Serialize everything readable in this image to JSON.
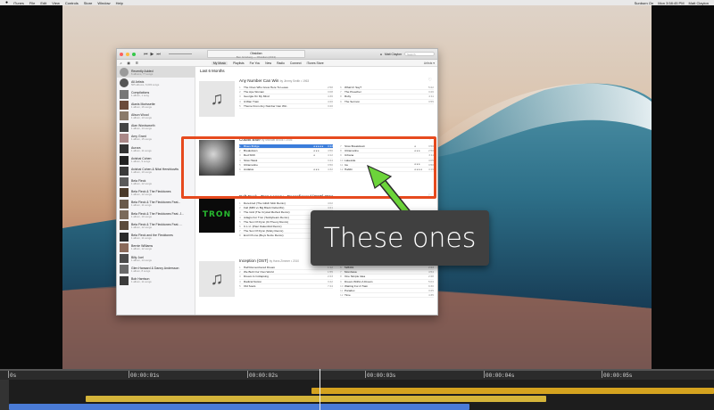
{
  "menubar": {
    "apple": "",
    "items": [
      "iTunes",
      "File",
      "Edit",
      "View",
      "Controls",
      "Store",
      "Window",
      "Help"
    ],
    "right": [
      "Sunburn On",
      "Mon 3:58:45 PM",
      "Matt Clayton"
    ]
  },
  "itunes": {
    "now_playing_title": "Obsidian",
    "now_playing_sub": "Ben Ginsberg — Obsidian (2013)",
    "user": "Matt Clayton",
    "search_placeholder": "Search",
    "nav_tabs": [
      "My Music",
      "Playlists",
      "For You",
      "New",
      "Radio",
      "Connect",
      "iTunes Store"
    ],
    "sort_label": "Artists ▾",
    "section_title": "Last 6 Months",
    "sidebar": [
      {
        "name": "Recently Added",
        "sub": "6 albums, 77 songs"
      },
      {
        "name": "All Artists",
        "sub": "505 albums, 6,003 songs"
      },
      {
        "name": "Compilations",
        "sub": "1 album, 1 song"
      },
      {
        "name": "Alanis Morissette",
        "sub": "1 album, 16 songs"
      },
      {
        "name": "Alison Wood",
        "sub": "1 album, 13 songs"
      },
      {
        "name": "Alan Wordsworth",
        "sub": "1 album, 14 songs"
      },
      {
        "name": "Amy Grant",
        "sub": "1 album, 15 songs"
      },
      {
        "name": "Aurora",
        "sub": "1 album, 11 songs"
      },
      {
        "name": "Avishai Cohen",
        "sub": "1 album, 9 songs"
      },
      {
        "name": "Avishai Cohen & Nitai Hershkovits",
        "sub": "1 album, 10 songs"
      },
      {
        "name": "Bela Fleck",
        "sub": "1 album, 12 songs"
      },
      {
        "name": "Bela Fleck & The Flecktones",
        "sub": "1 album, 12 songs"
      },
      {
        "name": "Bela Fleck & The Flecktones Feat...",
        "sub": "1 album, 11 songs"
      },
      {
        "name": "Bela Fleck & The Flecktones Feat. J...",
        "sub": "1 album, 10 songs"
      },
      {
        "name": "Bela Fleck & The Flecktones Feat. ...",
        "sub": "1 album, 12 songs"
      },
      {
        "name": "Bela Fleck and the Flecktones",
        "sub": "1 album, 11 songs"
      },
      {
        "name": "Bernie Williams",
        "sub": "1 album, 12 songs"
      },
      {
        "name": "Billy Joel",
        "sub": "1 album, 14 songs"
      },
      {
        "name": "Glen Hansard & Danny Andersson",
        "sub": "1 album, 8 songs"
      },
      {
        "name": "Bob Harrison",
        "sub": "1 album, 11 songs"
      }
    ],
    "albums": [
      {
        "title": "Any Number Can Win",
        "by": "by Jimmy Smith • 1963",
        "tracks_left": [
          {
            "n": "1",
            "name": "The Ones Who Grew Here To Leave",
            "time": "2:58"
          },
          {
            "n": "2",
            "name": "The Ape Woman",
            "time": "3:08"
          },
          {
            "n": "3",
            "name": "Georgia On My Mind",
            "time": "4:36"
          },
          {
            "n": "4",
            "name": "G'Wan Train",
            "time": "4:20"
          },
          {
            "n": "5",
            "name": "Theme From Any Number Can Win",
            "time": "3:20"
          }
        ],
        "tracks_right": [
          {
            "n": "6",
            "name": "What'd I Say?",
            "time": "5:22"
          },
          {
            "n": "7",
            "name": "The Preacher",
            "time": "3:26"
          },
          {
            "n": "8",
            "name": "Ruby",
            "time": "4:11"
          },
          {
            "n": "9",
            "name": "The Sermon",
            "time": "3:55"
          }
        ]
      },
      {
        "title": "Cobalt Blue",
        "by": "by Michael Brook • 2005",
        "tracks_left": [
          {
            "n": "1",
            "name": "Blues Bridge",
            "stars": "★★★★★",
            "time": "3:13",
            "playing": true
          },
          {
            "n": "2",
            "name": "Breakdown",
            "stars": "★★★",
            "time": "4:50"
          },
          {
            "n": "3",
            "name": "Red Shift",
            "stars": "★",
            "time": "4:12"
          },
          {
            "n": "4",
            "name": "Slow Hawk",
            "stars": "",
            "time": "3:24"
          },
          {
            "n": "5",
            "name": "Ultramarine",
            "stars": "",
            "time": "3:50"
          },
          {
            "n": "6",
            "name": "Andalus",
            "stars": "★★★",
            "time": "4:32"
          }
        ],
        "tracks_right": [
          {
            "n": "7",
            "name": "Slow Breakdown",
            "stars": "★",
            "time": "3:50"
          },
          {
            "n": "8",
            "name": "Ultramarine",
            "stars": "★★★",
            "time": "2:50"
          },
          {
            "n": "9",
            "name": "Urbana",
            "stars": "",
            "time": "3:11"
          },
          {
            "n": "10",
            "name": "Lakeside",
            "stars": "",
            "time": "4:05"
          },
          {
            "n": "11",
            "name": "Ice",
            "stars": "★★★",
            "time": "3:50"
          },
          {
            "n": "12",
            "name": "Habibi",
            "stars": "★★★★",
            "time": "4:19"
          }
        ]
      },
      {
        "title": "Daft Punk - Tron Legacy - Reconfigured [OST] 2011",
        "by": "",
        "tracks_left": [
          {
            "n": "1",
            "name": "Derezzed (The Glitch Mob Remix)",
            "time": "4:02"
          },
          {
            "n": "2",
            "name": "Fall (M83 vs Big Black Delta Mix)",
            "time": "4:21"
          },
          {
            "n": "3",
            "name": "The Grid (The Crystal Method Remix)",
            "time": "3:40"
          },
          {
            "n": "4",
            "name": "Adagio For Tron (Teddybears Remix)",
            "time": "5:01"
          },
          {
            "n": "5",
            "name": "The Son Of Flynn (Ki:Theory Remix)",
            "time": "3:12"
          },
          {
            "n": "6",
            "name": "C.L.U. (Paul Oakenfold Remix)",
            "time": "4:40"
          },
          {
            "n": "7",
            "name": "The Son Of Flynn (Moby Remix)",
            "time": "3:05"
          },
          {
            "n": "8",
            "name": "End Of Line (Boys Noize Remix)",
            "time": "4:10"
          }
        ],
        "tracks_right": []
      },
      {
        "title": "Inception (OST)",
        "by": "by Hans Zimmer • 2010",
        "tracks_left": [
          {
            "n": "1",
            "name": "Half Remembered Dream",
            "time": "1:12"
          },
          {
            "n": "2",
            "name": "We Built Our Own World",
            "time": "1:55"
          },
          {
            "n": "3",
            "name": "Dream Is Collapsing",
            "time": "2:23"
          },
          {
            "n": "4",
            "name": "Radical Notion",
            "time": "3:42"
          },
          {
            "n": "5",
            "name": "Old Souls",
            "time": "7:44"
          }
        ],
        "tracks_right": [
          {
            "n": "6",
            "name": "528491",
            "time": "2:23"
          },
          {
            "n": "7",
            "name": "Mombasa",
            "time": "4:54"
          },
          {
            "n": "8",
            "name": "One Simple Idea",
            "time": "2:28"
          },
          {
            "n": "9",
            "name": "Dream Within A Dream",
            "time": "5:04"
          },
          {
            "n": "10",
            "name": "Waiting For A Train",
            "time": "9:30"
          },
          {
            "n": "11",
            "name": "Paradox",
            "time": "3:25"
          },
          {
            "n": "12",
            "name": "Time",
            "time": "4:35"
          }
        ]
      }
    ],
    "tron_art_text": "TRON"
  },
  "annotation": {
    "callout_text": "These ones",
    "box_color": "#e64a1e",
    "arrow_color": "#6cd43a"
  },
  "timeline": {
    "ticks": [
      "0s",
      "00:00:01s",
      "00:00:02s",
      "00:00:03s",
      "00:00:04s",
      "00:00:05s"
    ],
    "clip_colors": [
      "#d4a21f",
      "#d4b43a",
      "#4a7bd6"
    ]
  }
}
